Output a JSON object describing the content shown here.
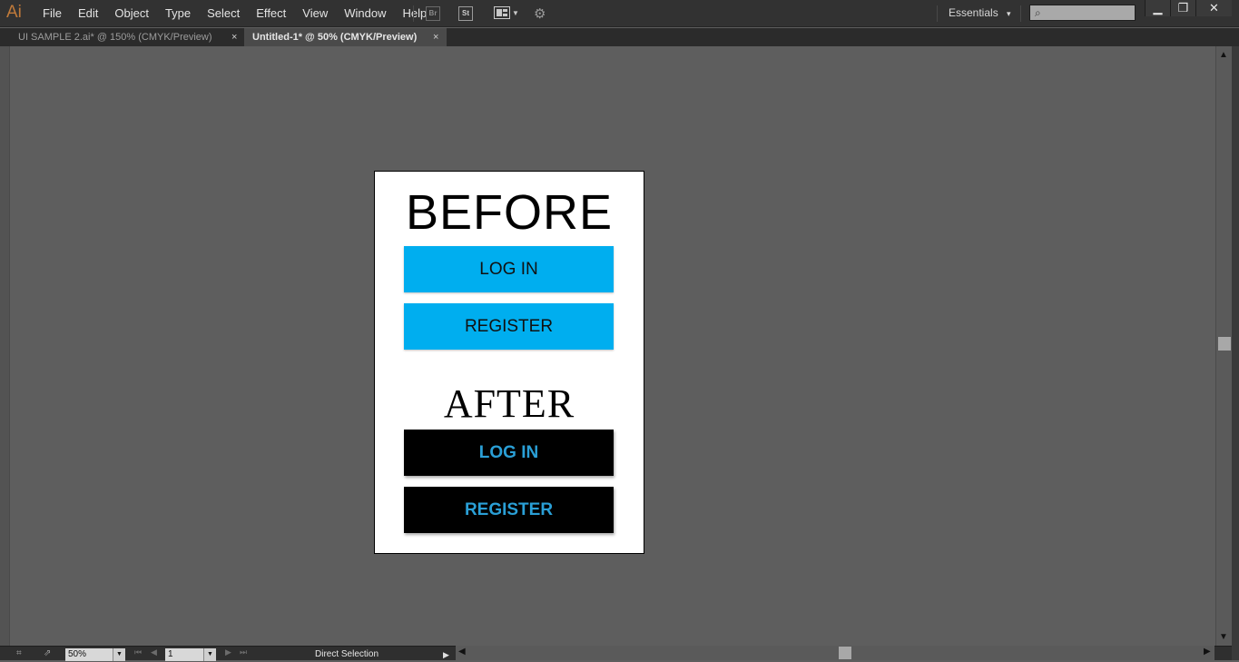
{
  "app": {
    "logo": "Ai"
  },
  "menu": [
    "File",
    "Edit",
    "Object",
    "Type",
    "Select",
    "Effect",
    "View",
    "Window",
    "Help"
  ],
  "toolbar": {
    "bridge_label": "Br",
    "stock_label": "St"
  },
  "workspace": {
    "label": "Essentials",
    "caret": "▾"
  },
  "window_controls": {
    "minimize": "▁",
    "restore": "❐",
    "close": "✕"
  },
  "tabs": [
    {
      "label": "UI SAMPLE 2.ai* @ 150% (CMYK/Preview)",
      "close": "×"
    },
    {
      "label": "Untitled-1* @ 50% (CMYK/Preview)",
      "close": "×"
    }
  ],
  "artboard": {
    "before_heading": "BEFORE",
    "after_heading": "AFTER",
    "before_buttons": [
      "LOG IN",
      "REGISTER"
    ],
    "after_buttons": [
      "LOG IN",
      "REGISTER"
    ]
  },
  "colors": {
    "before_button_bg": "#00aeef",
    "after_button_bg": "#000000",
    "after_button_text": "#2a9fd6"
  },
  "status": {
    "zoom": "50%",
    "page": "1",
    "tool": "Direct Selection"
  }
}
